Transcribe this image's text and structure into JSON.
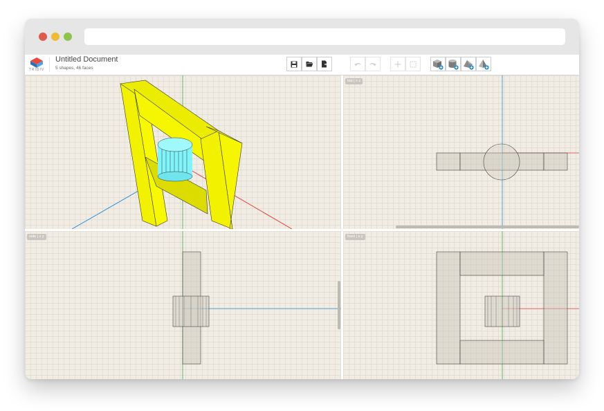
{
  "browser": {
    "window_buttons": [
      "close",
      "minimize",
      "maximize"
    ],
    "address": ""
  },
  "app": {
    "logo_text": "TRIDIV",
    "document": {
      "title": "Untitled Document",
      "subtitle": "5 shapes, 46 faces"
    },
    "toolbar": [
      {
        "name": "save",
        "icon": "floppy-icon",
        "enabled": true
      },
      {
        "name": "open",
        "icon": "folder-icon",
        "enabled": true
      },
      {
        "name": "export",
        "icon": "export-file-icon",
        "enabled": true
      },
      {
        "name": "undo",
        "icon": "undo-icon",
        "enabled": false
      },
      {
        "name": "redo",
        "icon": "redo-icon",
        "enabled": false
      },
      {
        "name": "move",
        "icon": "move-icon",
        "enabled": false
      },
      {
        "name": "select",
        "icon": "select-box-icon",
        "enabled": false
      },
      {
        "name": "add-cube",
        "icon": "add-cube-icon",
        "enabled": true
      },
      {
        "name": "add-cylinder",
        "icon": "add-cylinder-icon",
        "enabled": true
      },
      {
        "name": "add-prism",
        "icon": "add-prism-icon",
        "enabled": true
      },
      {
        "name": "add-pyramid",
        "icon": "add-pyramid-icon",
        "enabled": true
      }
    ]
  },
  "viewports": {
    "perspective": {
      "label": ""
    },
    "top": {
      "label": "top | x z"
    },
    "side": {
      "label": "side | z y"
    },
    "front": {
      "label": "front | x y"
    }
  },
  "colors": {
    "frame_shape": "#f5f500",
    "cylinder_shape": "#7ff4fb",
    "axis_x": "#e0443c",
    "axis_y": "#3fae4f",
    "axis_z": "#2a8fd6",
    "outline": "#444444"
  }
}
